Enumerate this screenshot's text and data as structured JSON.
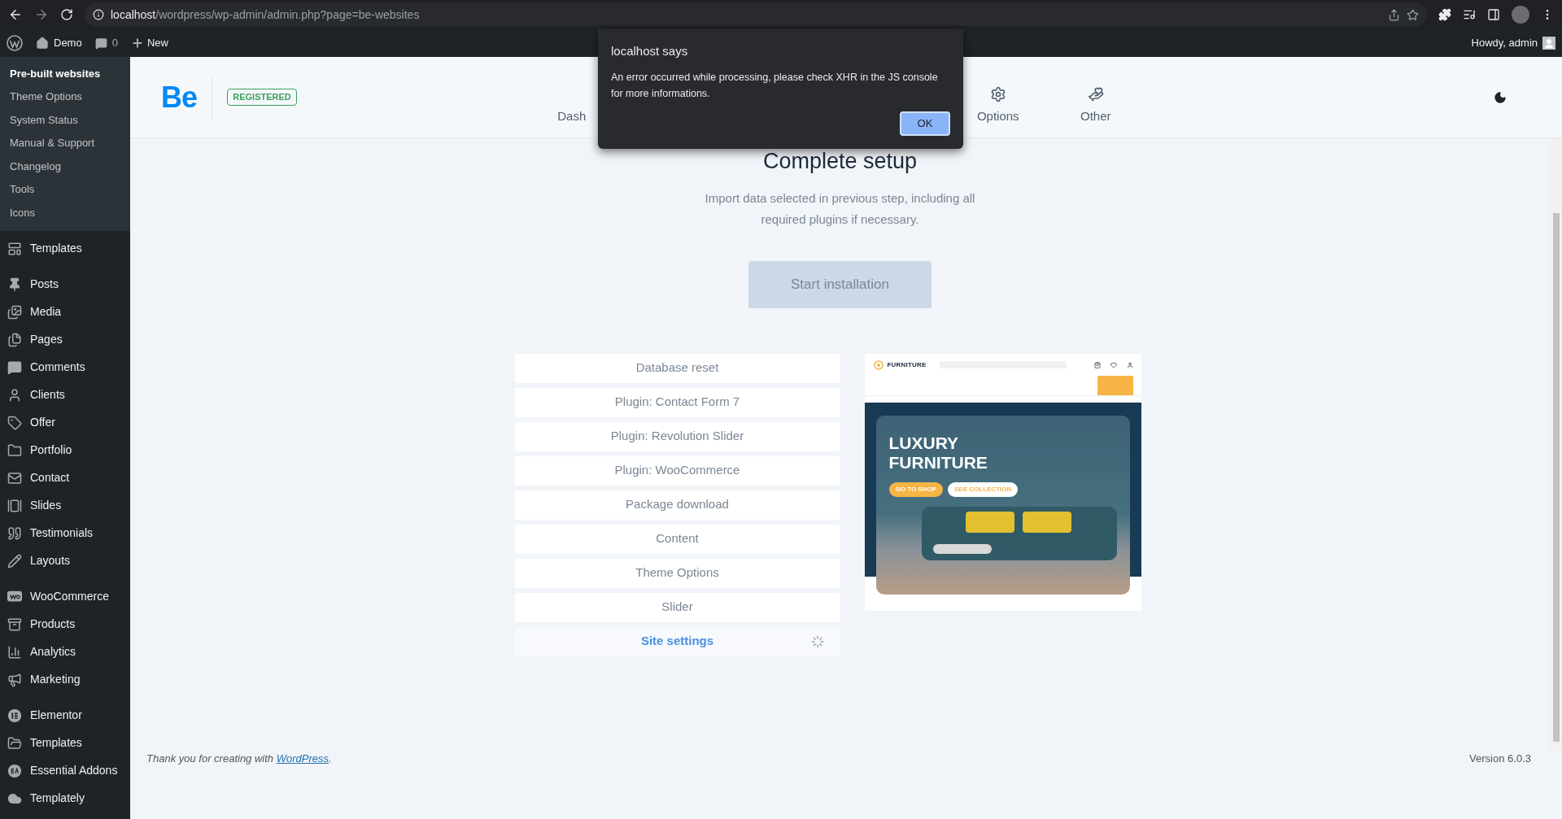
{
  "browser": {
    "url_host": "localhost",
    "url_path": "/wordpress/wp-admin/admin.php?page=be-websites"
  },
  "admin_bar": {
    "site": "Demo",
    "comments": "0",
    "new": "New",
    "greeting": "Howdy, admin"
  },
  "sidebar": {
    "submenu": [
      {
        "label": "Pre-built websites",
        "selected": true
      },
      {
        "label": "Theme Options",
        "selected": false
      },
      {
        "label": "System Status",
        "selected": false
      },
      {
        "label": "Manual & Support",
        "selected": false
      },
      {
        "label": "Changelog",
        "selected": false
      },
      {
        "label": "Tools",
        "selected": false
      },
      {
        "label": "Icons",
        "selected": false
      }
    ],
    "groups": [
      [
        {
          "label": "Templates"
        }
      ],
      [
        {
          "label": "Posts"
        },
        {
          "label": "Media"
        },
        {
          "label": "Pages"
        },
        {
          "label": "Comments"
        },
        {
          "label": "Clients"
        },
        {
          "label": "Offer"
        },
        {
          "label": "Portfolio"
        },
        {
          "label": "Contact"
        },
        {
          "label": "Slides"
        },
        {
          "label": "Testimonials"
        },
        {
          "label": "Layouts"
        }
      ],
      [
        {
          "label": "WooCommerce"
        },
        {
          "label": "Products"
        },
        {
          "label": "Analytics"
        },
        {
          "label": "Marketing"
        }
      ],
      [
        {
          "label": "Elementor"
        },
        {
          "label": "Templates"
        },
        {
          "label": "Essential Addons"
        },
        {
          "label": "Templately"
        }
      ]
    ]
  },
  "header": {
    "logo": "Be",
    "badge": "REGISTERED",
    "nav": [
      {
        "label": "Dash"
      },
      {
        "label": "Options"
      },
      {
        "label": "Other"
      }
    ]
  },
  "dialog": {
    "title": "localhost says",
    "message": "An error occurred while processing, please check XHR in the JS console for more informations.",
    "button": "OK"
  },
  "setup": {
    "title": "Complete setup",
    "description": "Import data selected in previous step, including all required plugins if necessary.",
    "button": {
      "label": "Start installation",
      "disabled": true
    },
    "steps": [
      {
        "label": "Database reset",
        "active": false
      },
      {
        "label": "Plugin: Contact Form 7",
        "active": false
      },
      {
        "label": "Plugin: Revolution Slider",
        "active": false
      },
      {
        "label": "Plugin: WooCommerce",
        "active": false
      },
      {
        "label": "Package download",
        "active": false
      },
      {
        "label": "Content",
        "active": false
      },
      {
        "label": "Theme Options",
        "active": false
      },
      {
        "label": "Slider",
        "active": false
      },
      {
        "label": "Site settings",
        "active": true
      }
    ]
  },
  "preview": {
    "brand": "FURNITURE",
    "headline": [
      "LUXURY",
      "FURNITURE"
    ],
    "buttons": [
      "GO TO SHOP",
      "SEE COLLECTION"
    ]
  },
  "footer": {
    "text_before": "Thank you for creating with ",
    "link": "WordPress",
    "text_after": ".",
    "version": "Version 6.0.3"
  }
}
